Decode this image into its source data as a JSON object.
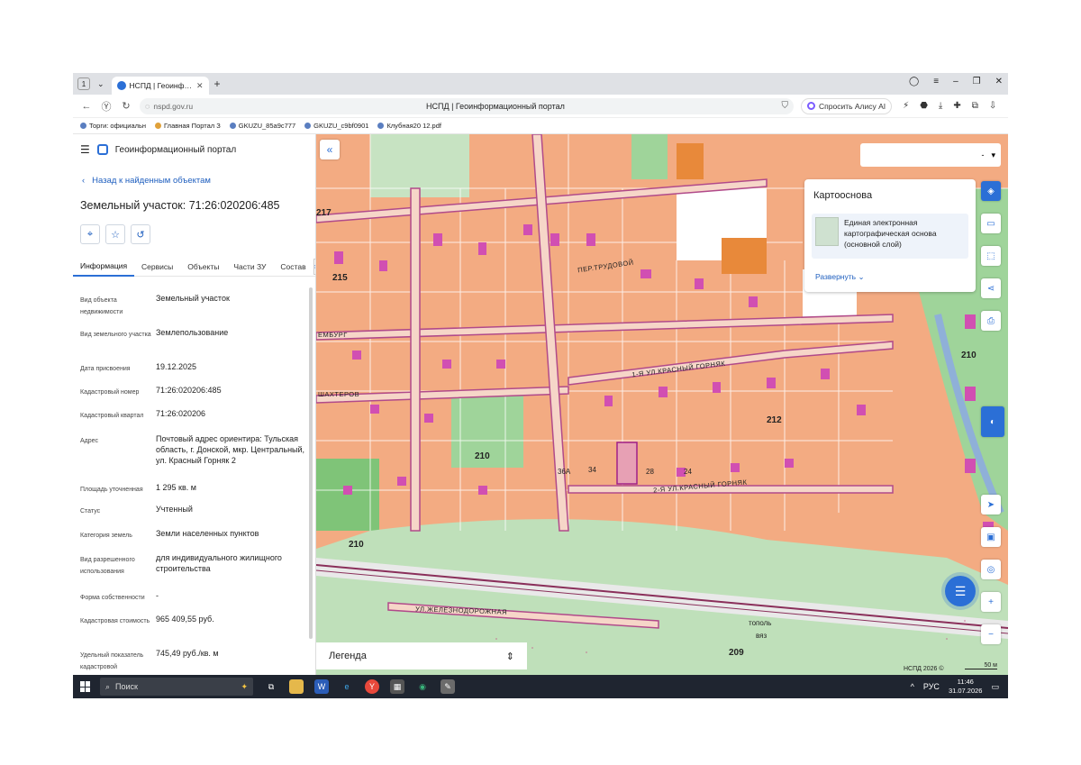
{
  "browser": {
    "tab_count": "1",
    "tab_title": "НСПД | Геоинформаци",
    "url": "nspd.gov.ru",
    "page_title": "НСПД | Геоинформационный портал",
    "alice_label": "Спросить Алису AI",
    "bookmarks": [
      "Торги: официальн",
      "Главная Портал З",
      "GKUZU_85a9c777",
      "GKUZU_c9bf0901",
      "Клубная20 12.pdf"
    ]
  },
  "panel": {
    "portal_name": "Геоинформационный портал",
    "back_link": "Назад к найденным объектам",
    "object_title": "Земельный участок: 71:26:020206:485",
    "tabs": [
      "Информация",
      "Сервисы",
      "Объекты",
      "Части ЗУ",
      "Состав"
    ],
    "properties": [
      {
        "label": "Вид объекта недвижимости",
        "value": "Земельный участок"
      },
      {
        "label": "Вид земельного участка",
        "value": "Землепользование"
      },
      {
        "label": "Дата присвоения",
        "value": "19.12.2025"
      },
      {
        "label": "Кадастровый номер",
        "value": "71:26:020206:485"
      },
      {
        "label": "Кадастровый квартал",
        "value": "71:26:020206"
      },
      {
        "label": "Адрес",
        "value": "Почтовый адрес ориентира: Тульская область, г. Донской, мкр. Центральный, ул. Красный Горняк 2"
      },
      {
        "label": "Площадь уточненная",
        "value": "1 295 кв. м"
      },
      {
        "label": "Статус",
        "value": "Учтенный"
      },
      {
        "label": "Категория земель",
        "value": "Земли населенных пунктов"
      },
      {
        "label": "Вид разрешенного использования",
        "value": "для индивидуального жилищного строительства"
      },
      {
        "label": "Форма собственности",
        "value": "-"
      },
      {
        "label": "Кадастровая стоимость",
        "value": "965 409,55 руб."
      },
      {
        "label": "Удельный показатель кадастровой",
        "value": "745,49 руб./кв. м"
      }
    ]
  },
  "map": {
    "layer_select": "-",
    "kartosnova": {
      "title": "Картооснова",
      "item": "Единая электронная картографическая основа (основной слой)",
      "expand": "Развернуть"
    },
    "legend": "Легенда",
    "copyright": "НСПД 2026 ©",
    "scale": "50 м",
    "labels": {
      "q212": "212",
      "q210": "210",
      "q210b": "210",
      "q210c": "210",
      "q209": "209",
      "q215": "215",
      "q217": "217",
      "street1": "ПЕР.ТРУДОВОЙ",
      "street2": "1-Я УЛ.КРАСНЫЙ ГОРНЯК",
      "street3": "2-Я УЛ.КРАСНЫЙ ГОРНЯК",
      "street4": "УЛ.ЖЕЛЕЗНОДОРОЖНАЯ",
      "street5": "ШАХТЕРОВ",
      "street6": "ЕМБУРГ",
      "topol": "тополь",
      "vyaz": "вяз",
      "n36a": "36А",
      "n34": "34",
      "n28": "28",
      "n24": "24"
    }
  },
  "taskbar": {
    "search": "Поиск",
    "lang": "РУС",
    "time": "11:46",
    "date": "31.07.2026"
  }
}
